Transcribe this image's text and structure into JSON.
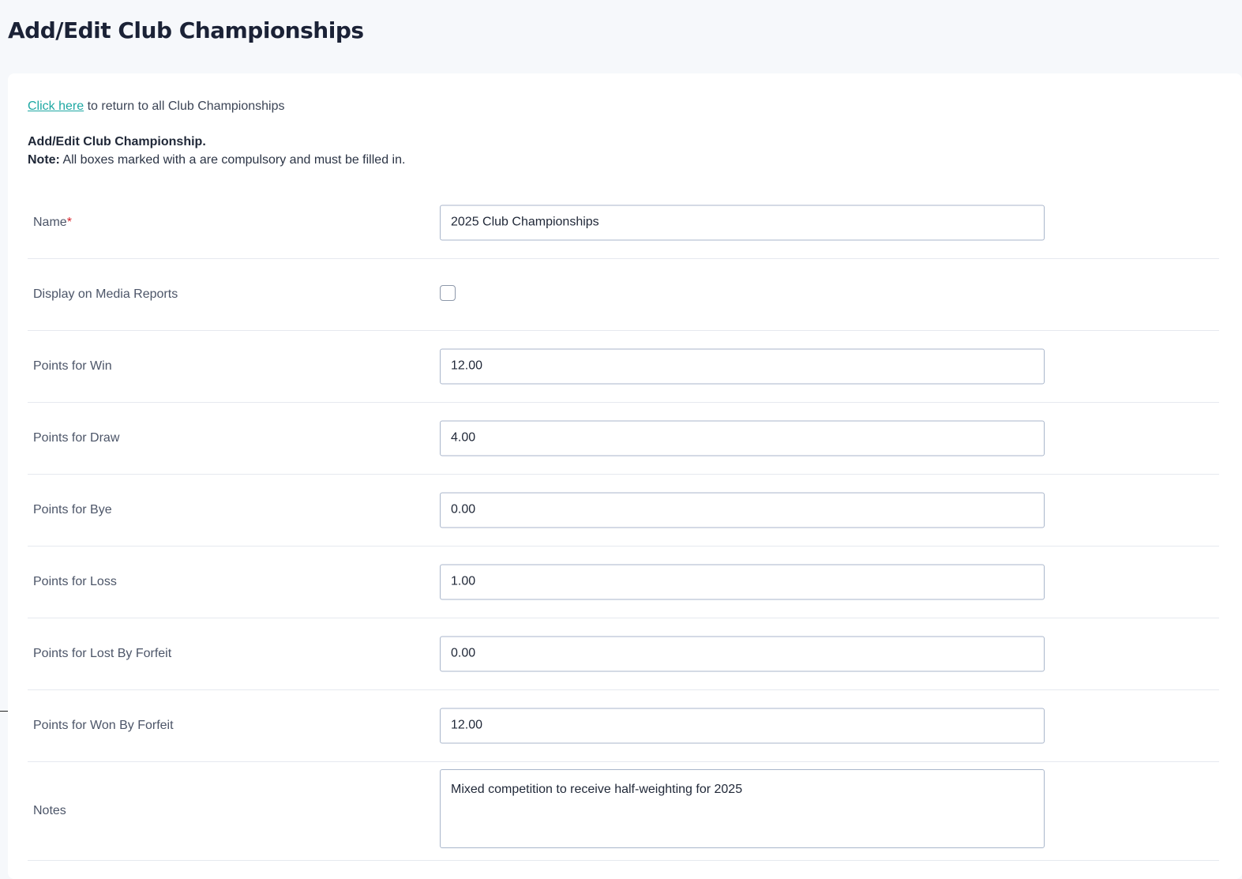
{
  "page": {
    "title": "Add/Edit Club Championships"
  },
  "intro": {
    "link_text": "Click here",
    "return_text": " to return to all Club Championships",
    "heading": "Add/Edit Club Championship.",
    "note_label": "Note:",
    "note_text": " All boxes marked with a are compulsory and must be filled in."
  },
  "form": {
    "name": {
      "label": "Name",
      "required_mark": "*",
      "value": "2025 Club Championships"
    },
    "display_media": {
      "label": "Display on Media Reports",
      "checked": false
    },
    "points_win": {
      "label": "Points for Win",
      "value": "12.00"
    },
    "points_draw": {
      "label": "Points for Draw",
      "value": "4.00"
    },
    "points_bye": {
      "label": "Points for Bye",
      "value": "0.00"
    },
    "points_loss": {
      "label": "Points for Loss",
      "value": "1.00"
    },
    "points_lost_forfeit": {
      "label": "Points for Lost By Forfeit",
      "value": "0.00"
    },
    "points_won_forfeit": {
      "label": "Points for Won By Forfeit",
      "value": "12.00"
    },
    "notes": {
      "label": "Notes",
      "value": "Mixed competition to receive half-weighting for 2025"
    }
  },
  "colors": {
    "link": "#1ea8a3",
    "required": "#d8232a",
    "input_border": "#a9b6cb",
    "page_bg": "#f6f8fb"
  }
}
